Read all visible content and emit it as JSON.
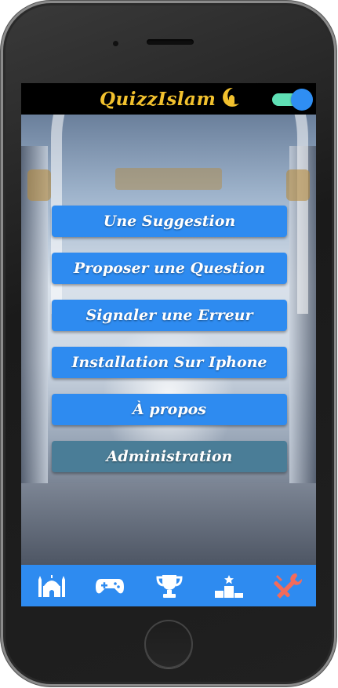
{
  "app": {
    "title": "QuizzIslam",
    "theme_toggle_on": true
  },
  "menu": {
    "items": [
      {
        "label": "Une Suggestion"
      },
      {
        "label": "Proposer une Question"
      },
      {
        "label": "Signaler une Erreur"
      },
      {
        "label": "Installation Sur Iphone"
      },
      {
        "label": "À propos"
      },
      {
        "label": "Administration"
      }
    ]
  },
  "tabbar": {
    "items": [
      {
        "icon": "mosque-icon"
      },
      {
        "icon": "gamepad-icon"
      },
      {
        "icon": "trophy-icon"
      },
      {
        "icon": "podium-icon"
      },
      {
        "icon": "tools-icon",
        "active": true
      }
    ]
  },
  "colors": {
    "accent": "#2e8bf0",
    "title": "#f2c12e",
    "admin_button": "#4a7d97",
    "active_tab_icon": "#f26b5b",
    "toggle_track": "#5fe0b5"
  }
}
